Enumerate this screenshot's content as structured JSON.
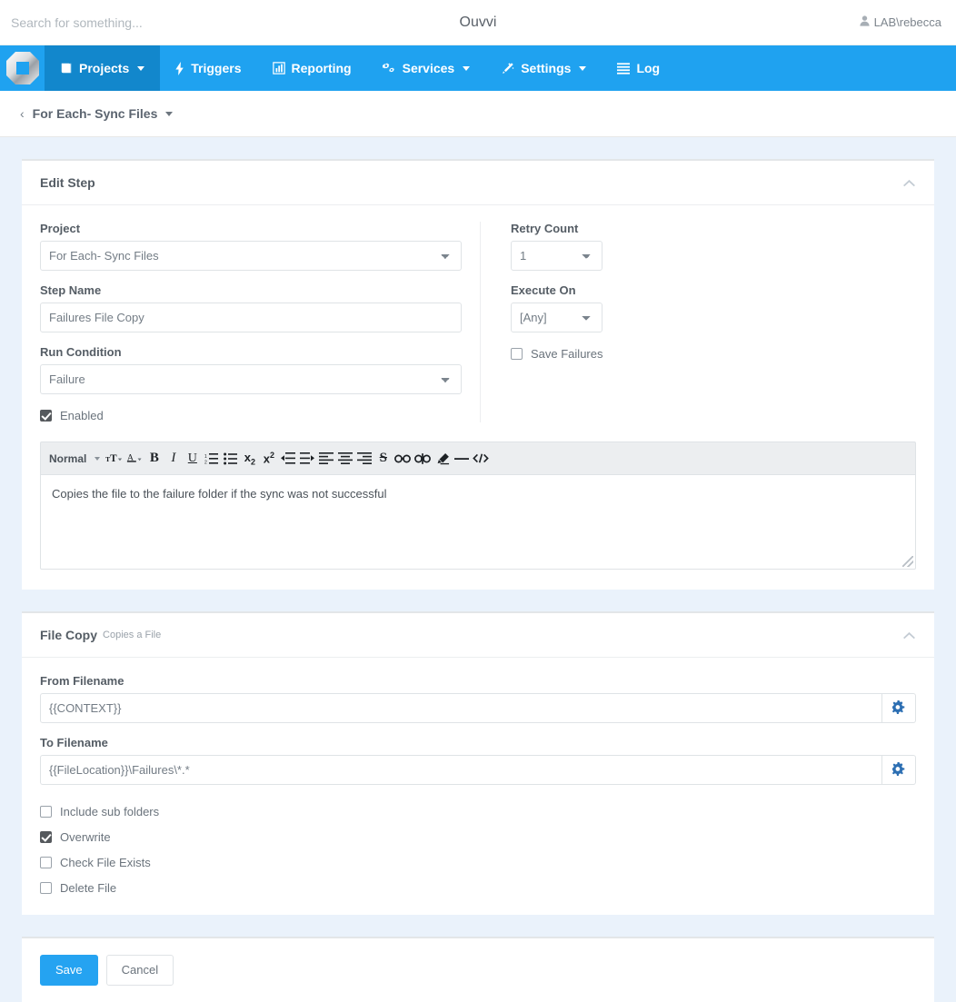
{
  "topbar": {
    "search_placeholder": "Search for something...",
    "search_value": "",
    "app_title": "Ouvvi",
    "user": "LAB\\rebecca",
    "user_icon": "user-icon"
  },
  "nav": {
    "logo_name": "ouvvi-logo",
    "items": [
      {
        "label": "Projects",
        "icon": "book-icon",
        "caret": true,
        "active": true
      },
      {
        "label": "Triggers",
        "icon": "bolt-icon",
        "caret": false,
        "active": false
      },
      {
        "label": "Reporting",
        "icon": "bar-chart-icon",
        "caret": false,
        "active": false
      },
      {
        "label": "Services",
        "icon": "cogs-icon",
        "caret": true,
        "active": false
      },
      {
        "label": "Settings",
        "icon": "magic-wand-icon",
        "caret": true,
        "active": false
      },
      {
        "label": "Log",
        "icon": "list-icon",
        "caret": false,
        "active": false
      }
    ]
  },
  "breadcrumb": {
    "back_icon": "chevron-left-icon",
    "label": "For Each- Sync Files",
    "caret_icon": "caret-down-icon"
  },
  "edit_step": {
    "title": "Edit Step",
    "collapse_icon": "chevron-up-icon",
    "project_label": "Project",
    "project_value": "For Each- Sync Files",
    "step_name_label": "Step Name",
    "step_name_value": "Failures File Copy",
    "run_condition_label": "Run Condition",
    "run_condition_value": "Failure",
    "enabled_label": "Enabled",
    "enabled_checked": true,
    "retry_count_label": "Retry Count",
    "retry_count_value": "1",
    "execute_on_label": "Execute On",
    "execute_on_value": "[Any]",
    "save_failures_label": "Save Failures",
    "save_failures_checked": false
  },
  "editor": {
    "style_label": "Normal",
    "buttons": [
      "font-size-icon",
      "font-color-icon",
      "bold-icon",
      "italic-icon",
      "underline-icon",
      "ordered-list-icon",
      "unordered-list-icon",
      "subscript-icon",
      "superscript-icon",
      "outdent-icon",
      "indent-icon",
      "align-left-icon",
      "align-center-icon",
      "align-right-icon",
      "strikethrough-icon",
      "link-icon",
      "unlink-icon",
      "highlight-icon",
      "horizontal-rule-icon",
      "code-icon"
    ],
    "content": "Copies the file to the failure folder if the sync was not successful"
  },
  "file_copy": {
    "title": "File Copy",
    "subtitle": "Copies a File",
    "collapse_icon": "chevron-up-icon",
    "from_label": "From Filename",
    "from_value": "{{CONTEXT}}",
    "from_addon_icon": "gear-icon",
    "to_label": "To Filename",
    "to_value": "{{FileLocation}}\\Failures\\*.*",
    "to_addon_icon": "gear-icon",
    "options": [
      {
        "label": "Include sub folders",
        "checked": false
      },
      {
        "label": "Overwrite",
        "checked": true
      },
      {
        "label": "Check File Exists",
        "checked": false
      },
      {
        "label": "Delete File",
        "checked": false
      }
    ]
  },
  "actions": {
    "save_label": "Save",
    "cancel_label": "Cancel"
  },
  "colors": {
    "accent": "#1fa2f0",
    "accent_active": "#1287cc",
    "page_bg": "#eaf2fb",
    "addon_icon": "#2d6fb3"
  }
}
